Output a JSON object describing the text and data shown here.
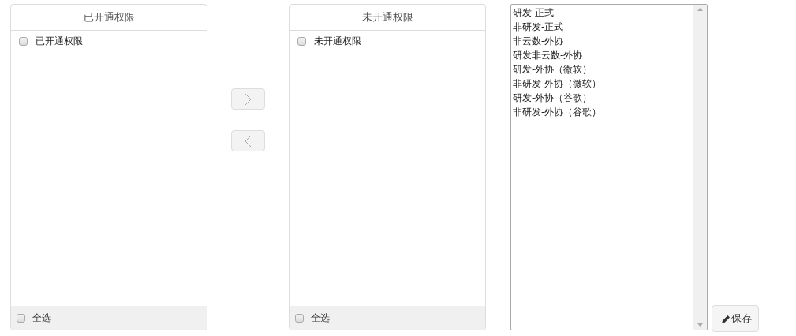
{
  "panels": [
    {
      "title": "已开通权限",
      "items": [
        {
          "label": "已开通权限",
          "checked": false
        }
      ],
      "select_all": {
        "label": "全选",
        "checked": false
      }
    },
    {
      "title": "未开通权限",
      "items": [
        {
          "label": "未开通权限",
          "checked": false
        }
      ],
      "select_all": {
        "label": "全选",
        "checked": false
      }
    }
  ],
  "transfer_buttons": [
    {
      "kind": "right",
      "disabled": true
    },
    {
      "kind": "left",
      "disabled": true
    }
  ],
  "listbox": {
    "options": [
      "研发-正式",
      "非研发-正式",
      "非云数-外协",
      "研发非云数-外协",
      "研发-外协（微软）",
      "非研发-外协（微软）",
      "研发-外协（谷歌）",
      "非研发-外协（谷歌）"
    ]
  },
  "save_button": {
    "label": "保存"
  }
}
